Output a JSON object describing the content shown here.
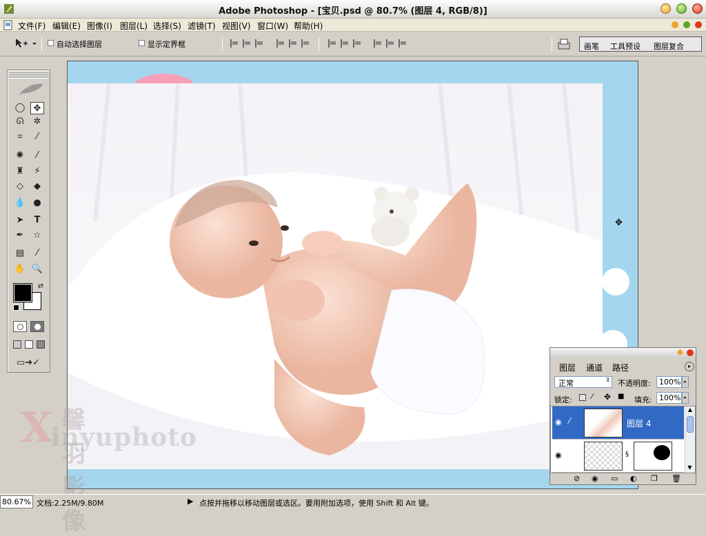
{
  "window": {
    "title": "Adobe Photoshop - [宝贝.psd @ 80.7% (图层 4, RGB/8)]"
  },
  "menu": [
    "文件(F)",
    "编辑(E)",
    "图像(I)",
    "图层(L)",
    "选择(S)",
    "滤镜(T)",
    "视图(V)",
    "窗口(W)",
    "帮助(H)"
  ],
  "options": {
    "auto_select": "自动选择图层",
    "show_bounds": "显示定界框"
  },
  "palette_tabs": [
    "画笔",
    "工具预设",
    "图层复合"
  ],
  "layers_panel": {
    "tabs": [
      "图层",
      "通道",
      "路径"
    ],
    "blend_mode": "正常",
    "opacity_label": "不透明度:",
    "opacity": "100%",
    "lock_label": "锁定:",
    "fill_label": "填充:",
    "fill": "100%",
    "layers": [
      {
        "name": "图层 4"
      },
      {
        "name": ""
      }
    ]
  },
  "watermark": {
    "cn": "馨羽影像",
    "x": "X",
    "en": "inyuphoto"
  },
  "status": {
    "zoom": "80.67%",
    "doc": "文档:2.25M/9.80M",
    "hint": "点按并拖移以移动图层或选区。要用附加选项，使用 Shift 和 Alt 键。"
  },
  "colors": {
    "selection": "#316ac5",
    "canvas_bg": "#a4d6ef"
  }
}
